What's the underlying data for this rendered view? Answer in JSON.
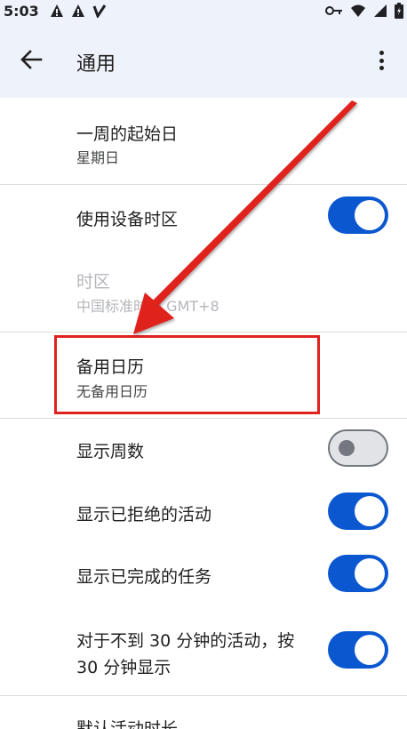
{
  "status_bar": {
    "time": "5:03",
    "left_icons": [
      "alert-icon",
      "alert-icon",
      "signal-v-icon"
    ],
    "right_icons": [
      "key-icon",
      "wifi-icon",
      "signal-icon",
      "battery-icon"
    ]
  },
  "app_bar": {
    "title": "通用",
    "back_icon": "arrow-left-icon",
    "more_icon": "more-vert-icon"
  },
  "settings": {
    "week_start": {
      "label": "一周的起始日",
      "value": "星期日"
    },
    "use_device_timezone": {
      "label": "使用设备时区",
      "enabled": true
    },
    "timezone": {
      "label": "时区",
      "value": "中国标准时间 GMT+8",
      "disabled": true
    },
    "alternate_calendar": {
      "label": "备用日历",
      "value": "无备用日历"
    },
    "show_week_number": {
      "label": "显示周数",
      "enabled": false
    },
    "show_declined": {
      "label": "显示已拒绝的活动",
      "enabled": true
    },
    "show_completed_tasks": {
      "label": "显示已完成的任务",
      "enabled": true
    },
    "short_events": {
      "label_line1": "对于不到 30 分钟的活动，按",
      "label_line2": "30 分钟显示",
      "enabled": true
    },
    "default_duration": {
      "label": "默认活动时长"
    }
  },
  "colors": {
    "accent": "#0b57d0",
    "highlight": "#e0221f",
    "appbar_bg": "#eef2fa"
  }
}
